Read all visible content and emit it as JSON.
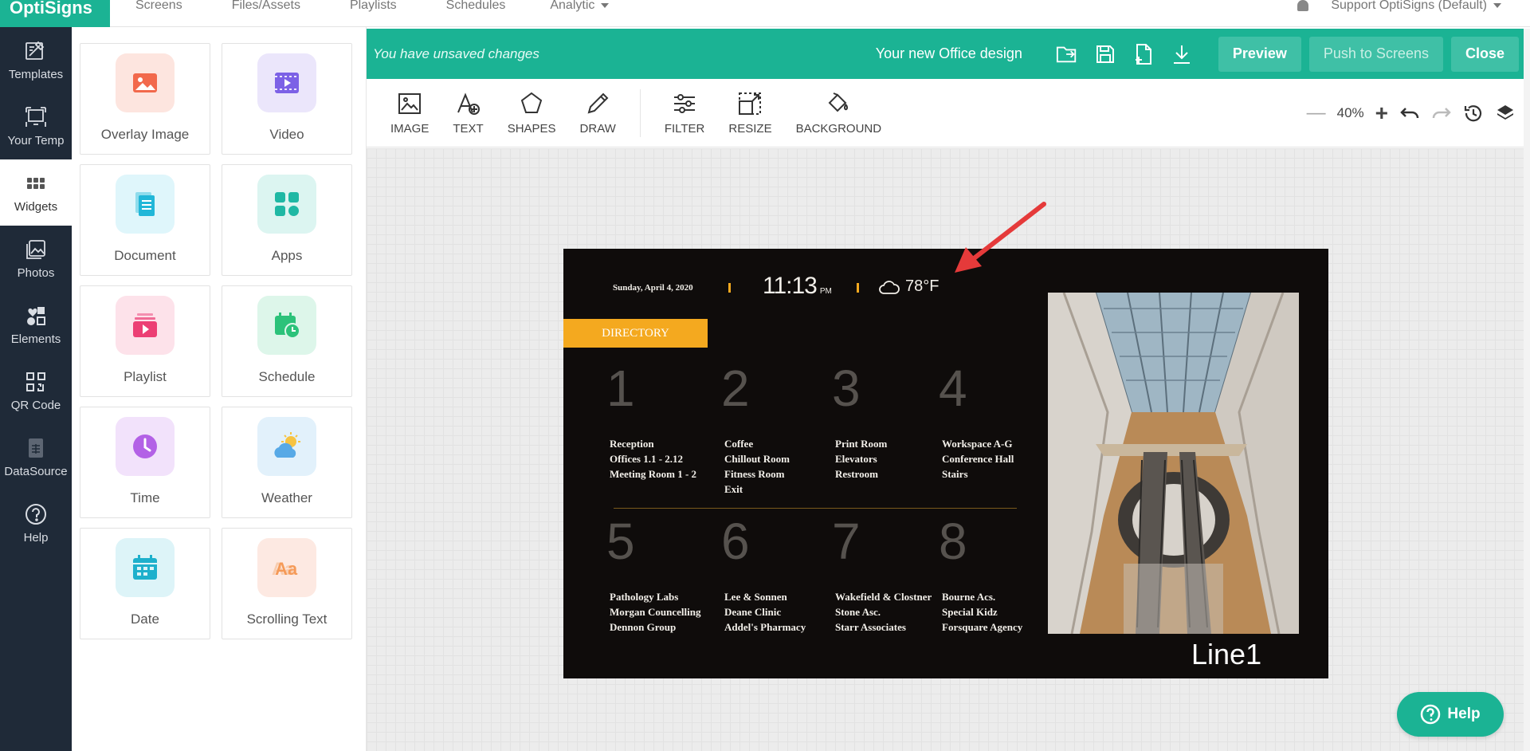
{
  "topnav": {
    "brand": "OptiSigns",
    "items": [
      "Screens",
      "Files/Assets",
      "Playlists",
      "Schedules"
    ],
    "analytic": "Analytic",
    "account": "Support OptiSigns (Default)"
  },
  "rail": {
    "items": [
      {
        "label": "Templates",
        "icon": "templates-icon"
      },
      {
        "label": "Your Temp",
        "icon": "your-templates-icon"
      },
      {
        "label": "Widgets",
        "icon": "widgets-icon",
        "active": true
      },
      {
        "label": "Photos",
        "icon": "photos-icon"
      },
      {
        "label": "Elements",
        "icon": "elements-icon"
      },
      {
        "label": "QR Code",
        "icon": "qr-code-icon"
      },
      {
        "label": "DataSource",
        "icon": "datasource-icon"
      },
      {
        "label": "Help",
        "icon": "help-icon"
      }
    ]
  },
  "widgets": [
    {
      "label": "Overlay Image",
      "icon": "overlay-image-icon",
      "bg": "#fde5df",
      "fg": "#f2694c"
    },
    {
      "label": "Video",
      "icon": "video-icon",
      "bg": "#ebe6fb",
      "fg": "#7c61e6"
    },
    {
      "label": "Document",
      "icon": "document-icon",
      "bg": "#dff6fb",
      "fg": "#22b7d8"
    },
    {
      "label": "Apps",
      "icon": "apps-icon",
      "bg": "#dcf5f1",
      "fg": "#1fb8a4"
    },
    {
      "label": "Playlist",
      "icon": "playlist-icon",
      "bg": "#fde2ea",
      "fg": "#ec3f74"
    },
    {
      "label": "Schedule",
      "icon": "schedule-icon",
      "bg": "#ddf6ea",
      "fg": "#2cc27a"
    },
    {
      "label": "Time",
      "icon": "clock-icon",
      "bg": "#f2e2fb",
      "fg": "#b361e6"
    },
    {
      "label": "Weather",
      "icon": "weather-icon",
      "bg": "#e2f1fb",
      "fg": "#57a9e6"
    },
    {
      "label": "Date",
      "icon": "calendar-icon",
      "bg": "#ddf4f8",
      "fg": "#1eb0cc"
    },
    {
      "label": "Scrolling Text",
      "icon": "scrolling-text-icon",
      "bg": "#fde9e2",
      "fg": "#f59a58"
    }
  ],
  "editor": {
    "unsaved": "You have unsaved changes",
    "design_name": "Your new Office design",
    "preview": "Preview",
    "push": "Push to Screens",
    "close": "Close"
  },
  "toolbar": {
    "tools": [
      "IMAGE",
      "TEXT",
      "SHAPES",
      "DRAW"
    ],
    "tools2": [
      "FILTER",
      "RESIZE",
      "BACKGROUND"
    ],
    "zoom": "40%"
  },
  "design": {
    "date": "Sunday, April 4, 2020",
    "time": "11:13",
    "ampm": "PM",
    "temperature": "78°F",
    "directory": "DIRECTORY",
    "sections": [
      {
        "num": "1",
        "lines": [
          "Reception",
          "Offices 1.1 - 2.12",
          "Meeting Room 1 - 2"
        ]
      },
      {
        "num": "2",
        "lines": [
          "Coffee",
          "Chillout Room",
          "Fitness Room",
          "Exit"
        ]
      },
      {
        "num": "3",
        "lines": [
          "Print Room",
          "Elevators",
          "Restroom"
        ]
      },
      {
        "num": "4",
        "lines": [
          "Workspace A-G",
          "Conference Hall",
          "Stairs"
        ]
      },
      {
        "num": "5",
        "lines": [
          "Pathology Labs",
          "Morgan Councelling",
          "Dennon Group"
        ]
      },
      {
        "num": "6",
        "lines": [
          "Lee & Sonnen",
          "Deane Clinic",
          "Addel's Pharmacy"
        ]
      },
      {
        "num": "7",
        "lines": [
          "Wakefield & Clostner",
          "Stone Asc.",
          "Starr Associates"
        ]
      },
      {
        "num": "8",
        "lines": [
          "Bourne Acs.",
          "Special Kidz",
          "Forsquare Agency"
        ]
      }
    ],
    "footer": "Line1"
  },
  "help_button": "Help"
}
